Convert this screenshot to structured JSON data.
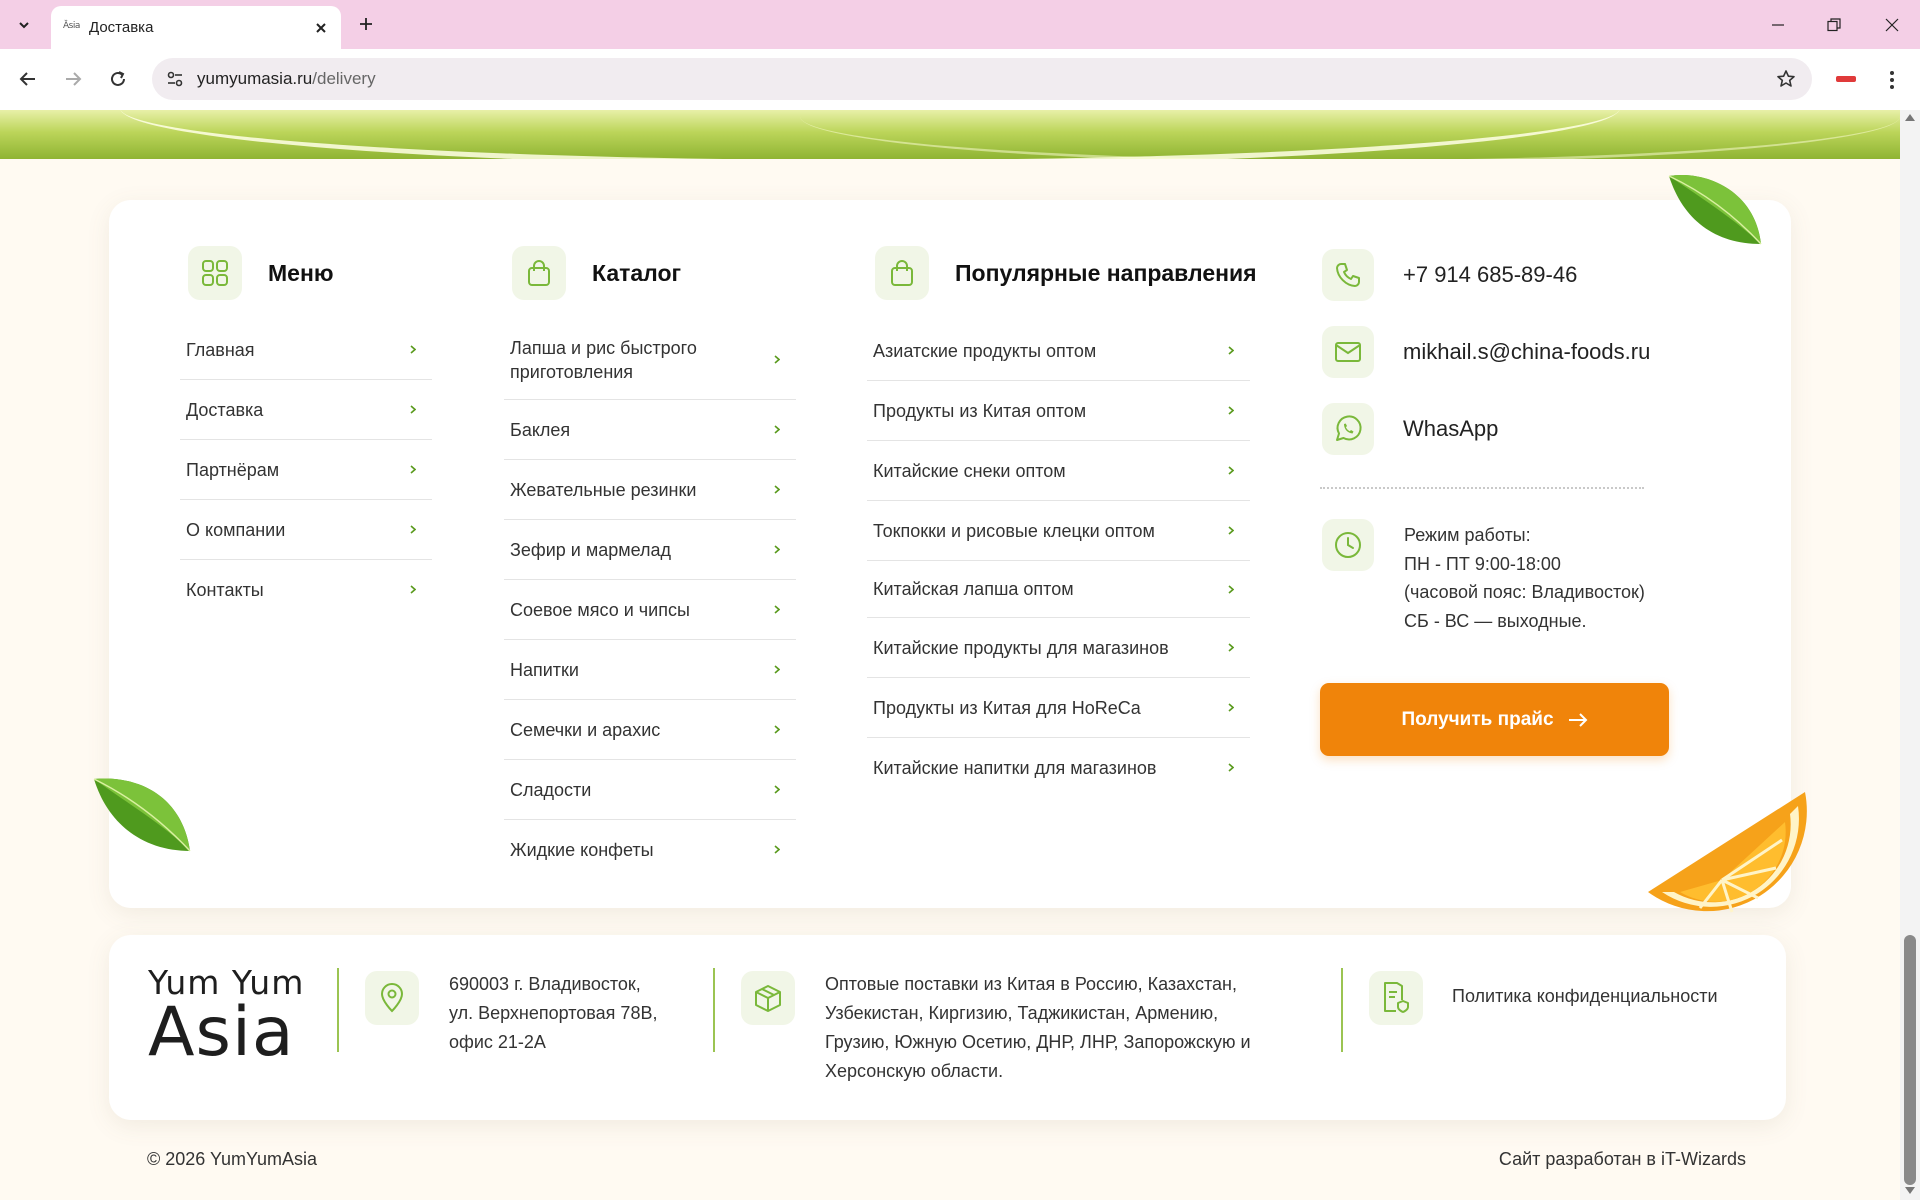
{
  "browser": {
    "tab_title": "Доставка",
    "tab_favicon_text": "Ȁsia",
    "url_domain": "yumyumasia.ru",
    "url_path": "/delivery"
  },
  "menu": {
    "title": "Меню",
    "items": [
      "Главная",
      "Доставка",
      "Партнёрам",
      "О компании",
      "Контакты"
    ]
  },
  "catalog": {
    "title": "Каталог",
    "items": [
      "Лапша и рис быстрого приготовления",
      "Баклея",
      "Жевательные резинки",
      "Зефир и мармелад",
      "Соевое мясо и чипсы",
      "Напитки",
      "Семечки и арахис",
      "Сладости",
      "Жидкие конфеты"
    ]
  },
  "popular": {
    "title": "Популярные направления",
    "items": [
      "Азиатские продукты оптом",
      "Продукты из Китая оптом",
      "Китайские снеки оптом",
      "Токпокки и рисовые клецки оптом",
      "Китайская лапша оптом",
      "Китайские продукты для магазинов",
      "Продукты из Китая для HoReCa",
      "Китайские напитки для магазинов"
    ]
  },
  "contacts": {
    "phone": "+7 914 685-89-46",
    "email": "mikhail.s@china-foods.ru",
    "whatsapp": "WhasApp",
    "hours": [
      "Режим работы:",
      "ПН - ПТ 9:00-18:00",
      "(часовой пояс: Владивосток)",
      "СБ - ВС — выходные."
    ],
    "price_button": "Получить прайс"
  },
  "footer": {
    "logo_line1": "Yum Yum",
    "logo_line2": "Asia",
    "address": [
      "690003 г. Владивосток,",
      "ул. Верхнепортовая 78В,",
      "офис 21-2А"
    ],
    "supply": [
      "Оптовые поставки из Китая в Россию, Казахстан,",
      "Узбекистан, Киргизию, Таджикистан, Армению,",
      "Грузию, Южную Осетию, ДНР, ЛНР, Запорожскую и",
      "Херсонскую области."
    ],
    "privacy": "Политика конфиденциальности",
    "copyright": "© 2026 YumYumAsia",
    "credits": "Сайт разработан в iT-Wizards"
  },
  "colors": {
    "accent_green": "#7ab83a",
    "accent_orange": "#f0840a",
    "icon_bg": "#f1f6e7"
  },
  "icons": [
    "grid-icon",
    "shopping-bag-icon",
    "phone-icon",
    "mail-icon",
    "whatsapp-icon",
    "clock-icon",
    "map-pin-icon",
    "package-icon",
    "document-shield-icon",
    "leaf-image",
    "orange-slice-image"
  ]
}
